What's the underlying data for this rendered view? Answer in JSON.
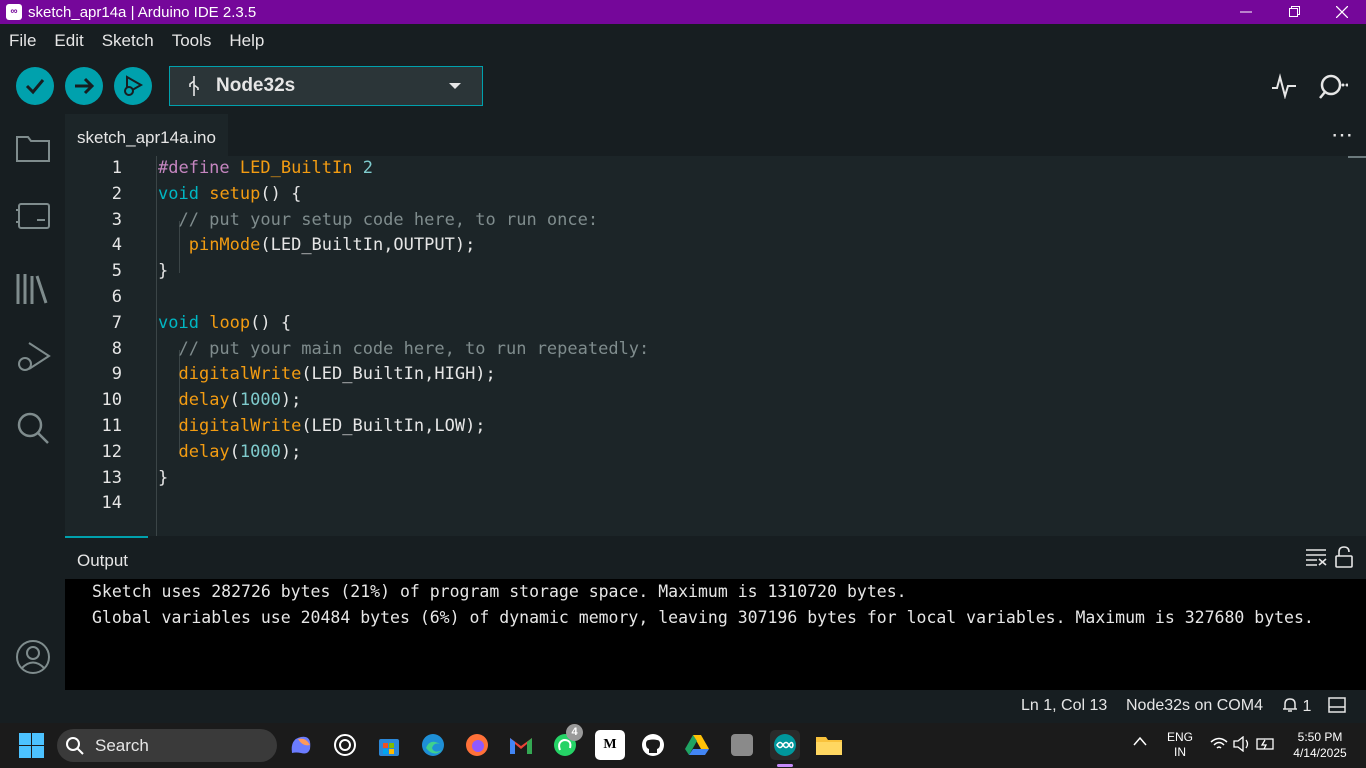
{
  "window": {
    "title": "sketch_apr14a | Arduino IDE 2.3.5",
    "app_icon": "infinity-icon",
    "controls": [
      "minimize-icon",
      "maximize-icon",
      "close-icon"
    ]
  },
  "menu": {
    "items": [
      "File",
      "Edit",
      "Sketch",
      "Tools",
      "Help"
    ]
  },
  "toolbar": {
    "buttons": [
      "verify-check-icon",
      "upload-arrow-icon",
      "debug-icon"
    ],
    "accent": "#00a1ad",
    "board": "Node32s",
    "right_icons": [
      "serial-plotter-icon",
      "serial-monitor-icon"
    ]
  },
  "sidebar": {
    "icons": [
      "sketchbook-folder-icon",
      "boards-manager-icon",
      "library-manager-icon",
      "debug-icon",
      "search-icon",
      "account-icon"
    ]
  },
  "editor": {
    "tab_name": "sketch_apr14a.ino",
    "more_label": "⋯",
    "lines": [
      {
        "n": "1",
        "parts": [
          [
            "#define",
            "kw-pre"
          ],
          [
            " LED_BuiltIn ",
            "kw-fn"
          ],
          [
            "2",
            "num"
          ]
        ]
      },
      {
        "n": "2",
        "parts": [
          [
            "void",
            "kw-type"
          ],
          [
            " ",
            ""
          ],
          [
            "setup",
            "kw-fn"
          ],
          [
            "() {",
            ""
          ]
        ]
      },
      {
        "n": "3",
        "parts": [
          [
            "  // put your setup code here, to run once:",
            "cm"
          ]
        ]
      },
      {
        "n": "4",
        "parts": [
          [
            "   ",
            ""
          ],
          [
            "pinMode",
            "kw-fn"
          ],
          [
            "(LED_BuiltIn,OUTPUT);",
            ""
          ]
        ]
      },
      {
        "n": "5",
        "parts": [
          [
            "}",
            ""
          ]
        ]
      },
      {
        "n": "6",
        "parts": []
      },
      {
        "n": "7",
        "parts": [
          [
            "void",
            "kw-type"
          ],
          [
            " ",
            ""
          ],
          [
            "loop",
            "kw-fn"
          ],
          [
            "() {",
            ""
          ]
        ]
      },
      {
        "n": "8",
        "parts": [
          [
            "  // put your main code here, to run repeatedly:",
            "cm"
          ]
        ]
      },
      {
        "n": "9",
        "parts": [
          [
            "  ",
            ""
          ],
          [
            "digitalWrite",
            "kw-fn"
          ],
          [
            "(LED_BuiltIn,HIGH);",
            ""
          ]
        ]
      },
      {
        "n": "10",
        "parts": [
          [
            "  ",
            ""
          ],
          [
            "delay",
            "kw-fn"
          ],
          [
            "(",
            ""
          ],
          [
            "1000",
            "num"
          ],
          [
            ");",
            ""
          ]
        ]
      },
      {
        "n": "11",
        "parts": [
          [
            "  ",
            ""
          ],
          [
            "digitalWrite",
            "kw-fn"
          ],
          [
            "(LED_BuiltIn,LOW);",
            ""
          ]
        ]
      },
      {
        "n": "12",
        "parts": [
          [
            "  ",
            ""
          ],
          [
            "delay",
            "kw-fn"
          ],
          [
            "(",
            ""
          ],
          [
            "1000",
            "num"
          ],
          [
            ");",
            ""
          ]
        ]
      },
      {
        "n": "13",
        "parts": [
          [
            "}",
            ""
          ]
        ]
      },
      {
        "n": "14",
        "parts": []
      }
    ]
  },
  "output": {
    "title": "Output",
    "lines": [
      "Sketch uses 282726 bytes (21%) of program storage space. Maximum is 1310720 bytes.",
      "Global variables use 20484 bytes (6%) of dynamic memory, leaving 307196 bytes for local variables. Maximum is 327680 bytes."
    ],
    "icons": [
      "clear-output-icon",
      "scroll-lock-icon"
    ]
  },
  "status": {
    "cursor": "Ln 1, Col 13",
    "port": "Node32s on COM4",
    "notifications": "1",
    "panel_icon": "toggle-panel-icon"
  },
  "taskbar": {
    "search_label": "Search",
    "apps": [
      "copilot-icon",
      "chatgpt-icon",
      "microsoft-store-icon",
      "edge-icon",
      "firefox-icon",
      "gmail-icon",
      "whatsapp-icon",
      "medium-icon",
      "github-icon",
      "google-drive-icon",
      "blank-app-icon",
      "arduino-icon",
      "file-explorer-icon"
    ],
    "whatsapp_badge": "4",
    "medium_label": "M",
    "lang_top": "ENG",
    "lang_bottom": "IN",
    "time": "5:50 PM",
    "date": "4/14/2025"
  }
}
